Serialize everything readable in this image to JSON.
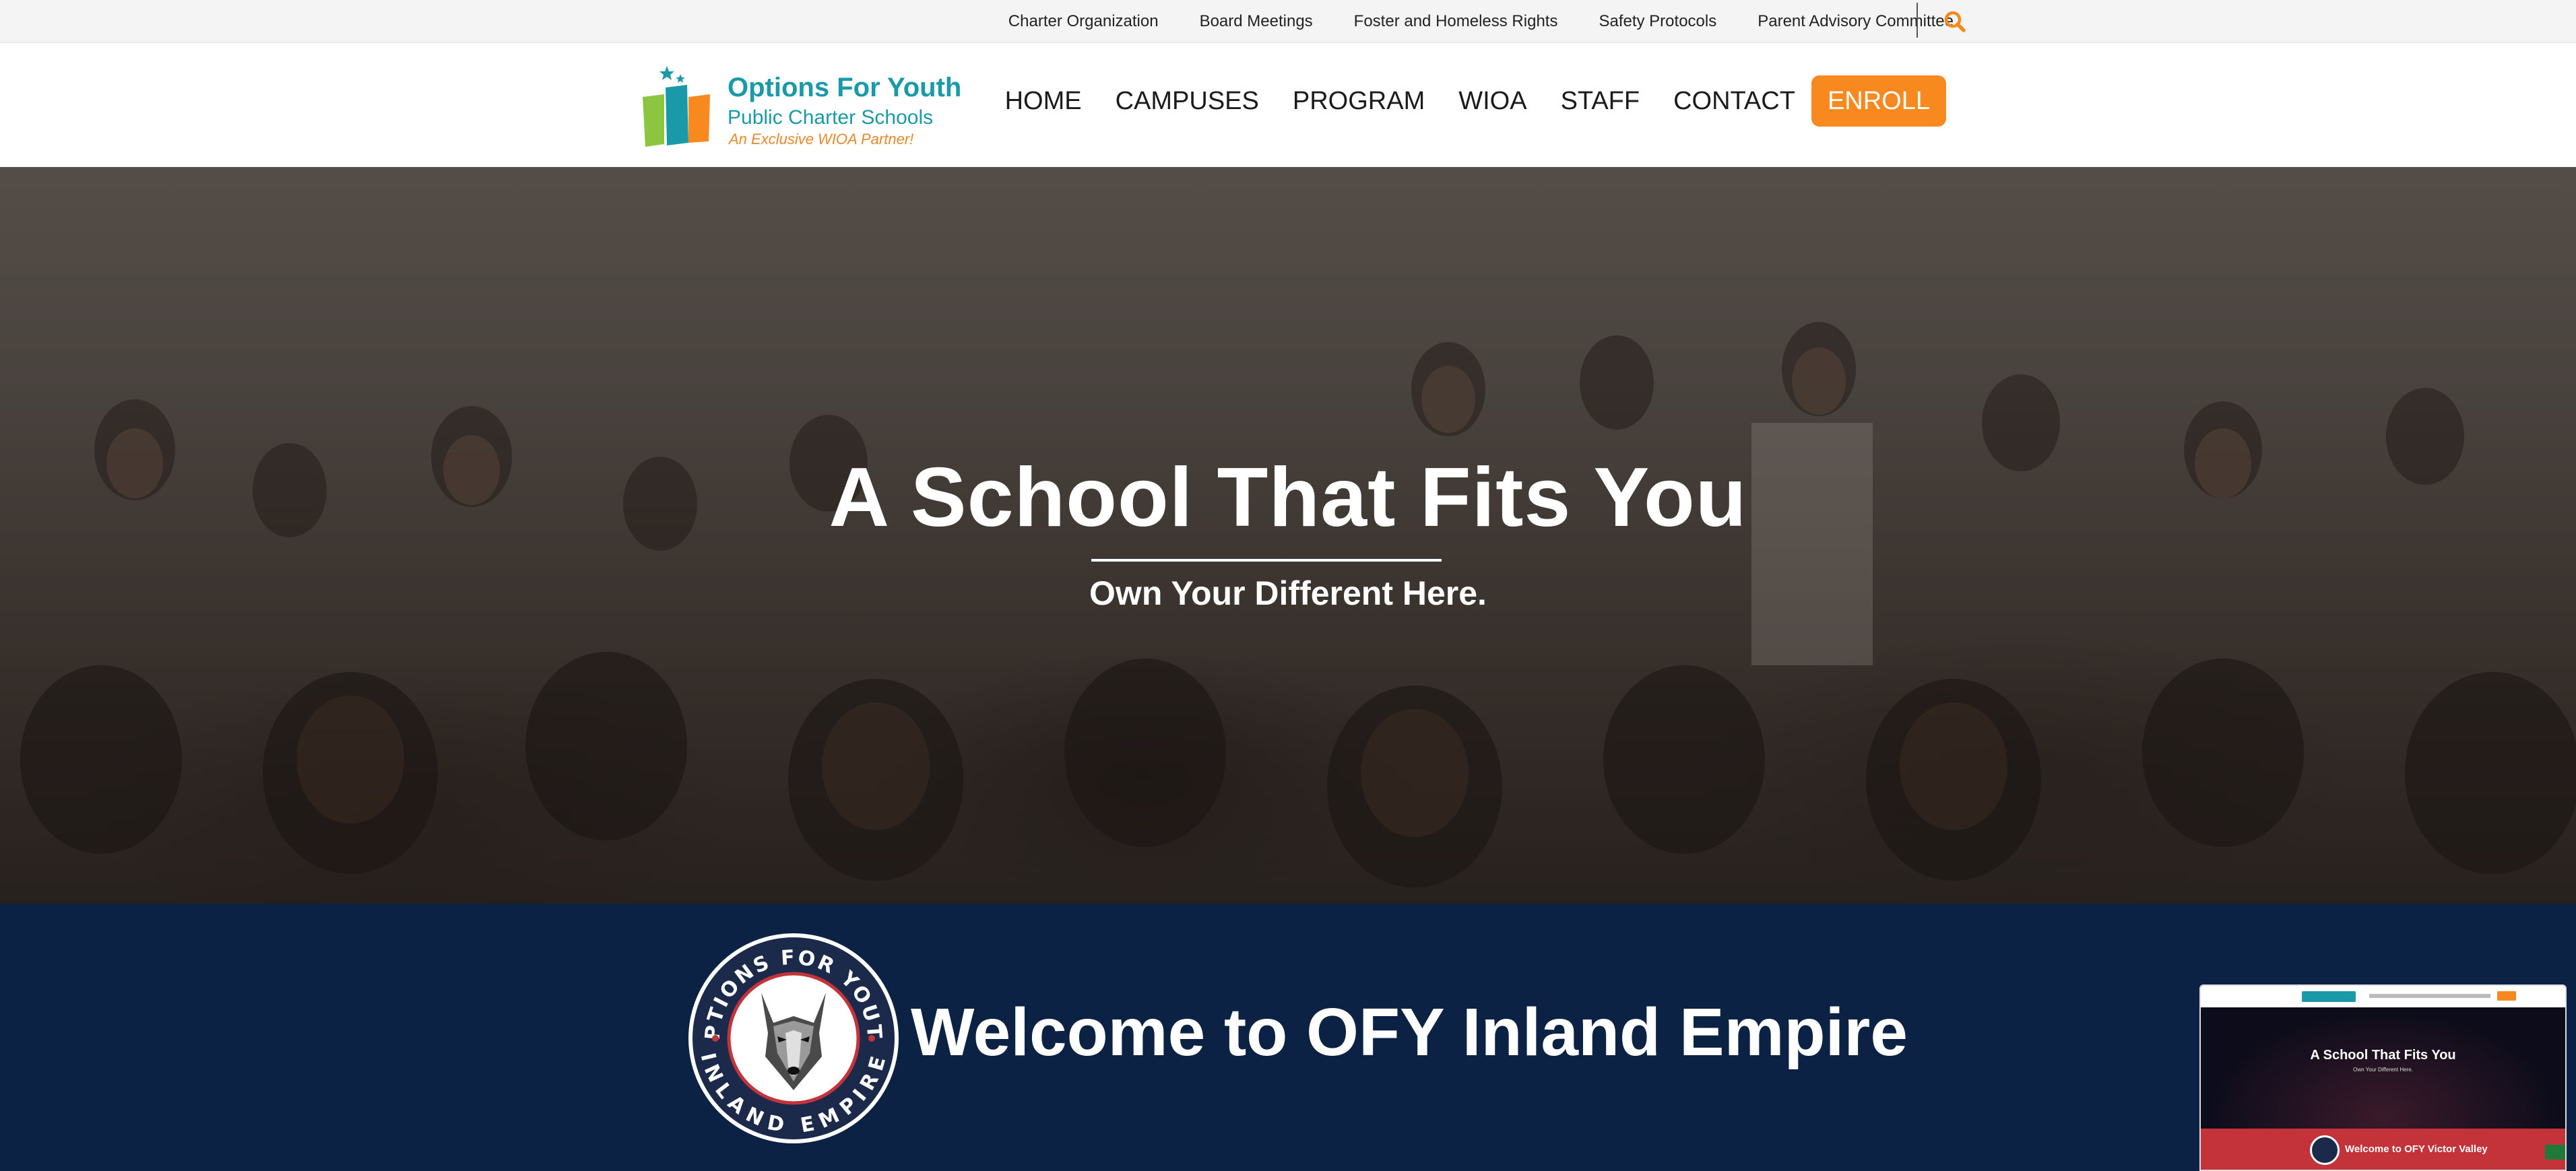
{
  "utility_nav": {
    "links": [
      {
        "label": "Charter Organization"
      },
      {
        "label": "Board Meetings"
      },
      {
        "label": "Foster and Homeless Rights"
      },
      {
        "label": "Safety Protocols"
      },
      {
        "label": "Parent Advisory Committee"
      }
    ],
    "search_icon": "search-icon"
  },
  "logo": {
    "title": "Options For Youth",
    "subtitle": "Public Charter Schools",
    "tagline": "An Exclusive WIOA Partner!"
  },
  "main_nav": {
    "items": [
      {
        "label": "HOME"
      },
      {
        "label": "CAMPUSES"
      },
      {
        "label": "PROGRAM"
      },
      {
        "label": "WIOA"
      },
      {
        "label": "STAFF"
      },
      {
        "label": "CONTACT"
      }
    ],
    "enroll_label": "ENROLL"
  },
  "hero": {
    "title": "A School That Fits You",
    "subtitle": "Own Your Different Here."
  },
  "welcome": {
    "title": "Welcome to OFY Inland Empire",
    "seal_top_text": "OPTIONS FOR YOUTH",
    "seal_bottom_text": "INLAND EMPIRE"
  },
  "preview": {
    "hero_title": "A School That Fits You",
    "hero_subtitle": "Own Your Different Here.",
    "welcome_title": "Welcome to OFY Victor Valley"
  },
  "colors": {
    "accent_orange": "#f7891e",
    "brand_teal": "#1a9aa8",
    "navy": "#0b2244",
    "preview_band_red": "#c4323a"
  }
}
